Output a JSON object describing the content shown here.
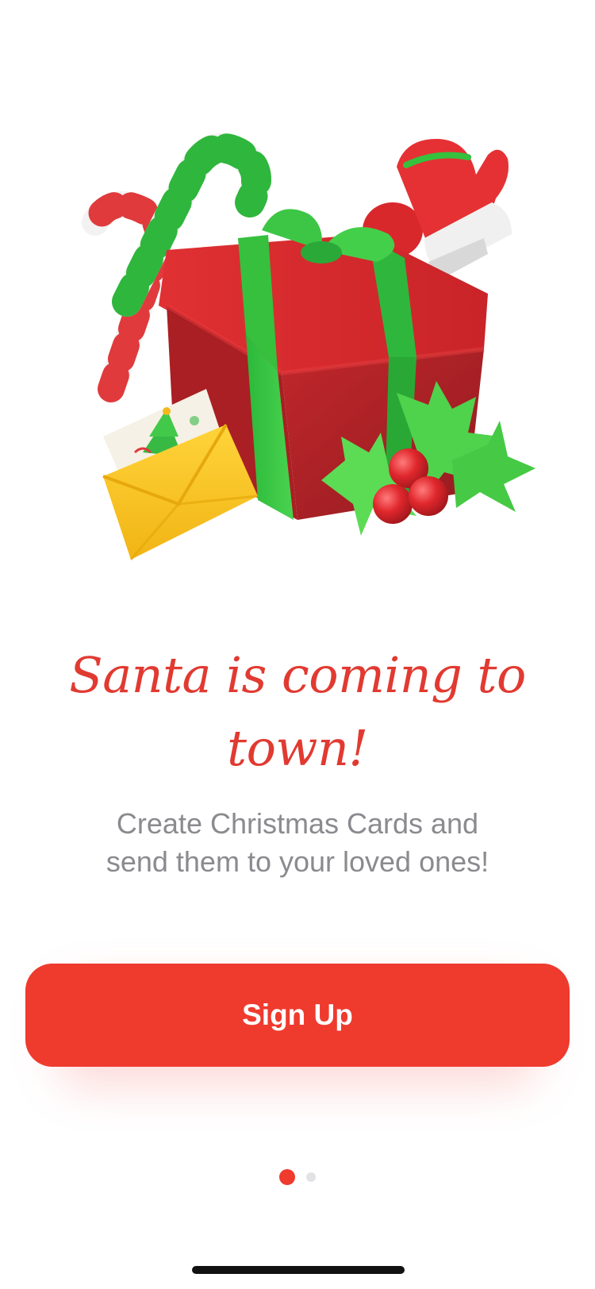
{
  "onboarding": {
    "title_line1": "Santa is coming to",
    "title_line2": "town!",
    "subtitle_line1": "Create Christmas Cards and",
    "subtitle_line2": "send them to your loved ones!",
    "signup_label": "Sign Up",
    "page_indicator": {
      "current": 1,
      "total": 2
    }
  },
  "colors": {
    "accent": "#ef3a2e",
    "title": "#e13a31",
    "subtitle": "#8a8a8f",
    "dot_inactive": "#e3e3e6"
  },
  "icons": [
    "christmas-gift-illustration",
    "candy-cane",
    "mitten",
    "envelope-card",
    "holly"
  ]
}
